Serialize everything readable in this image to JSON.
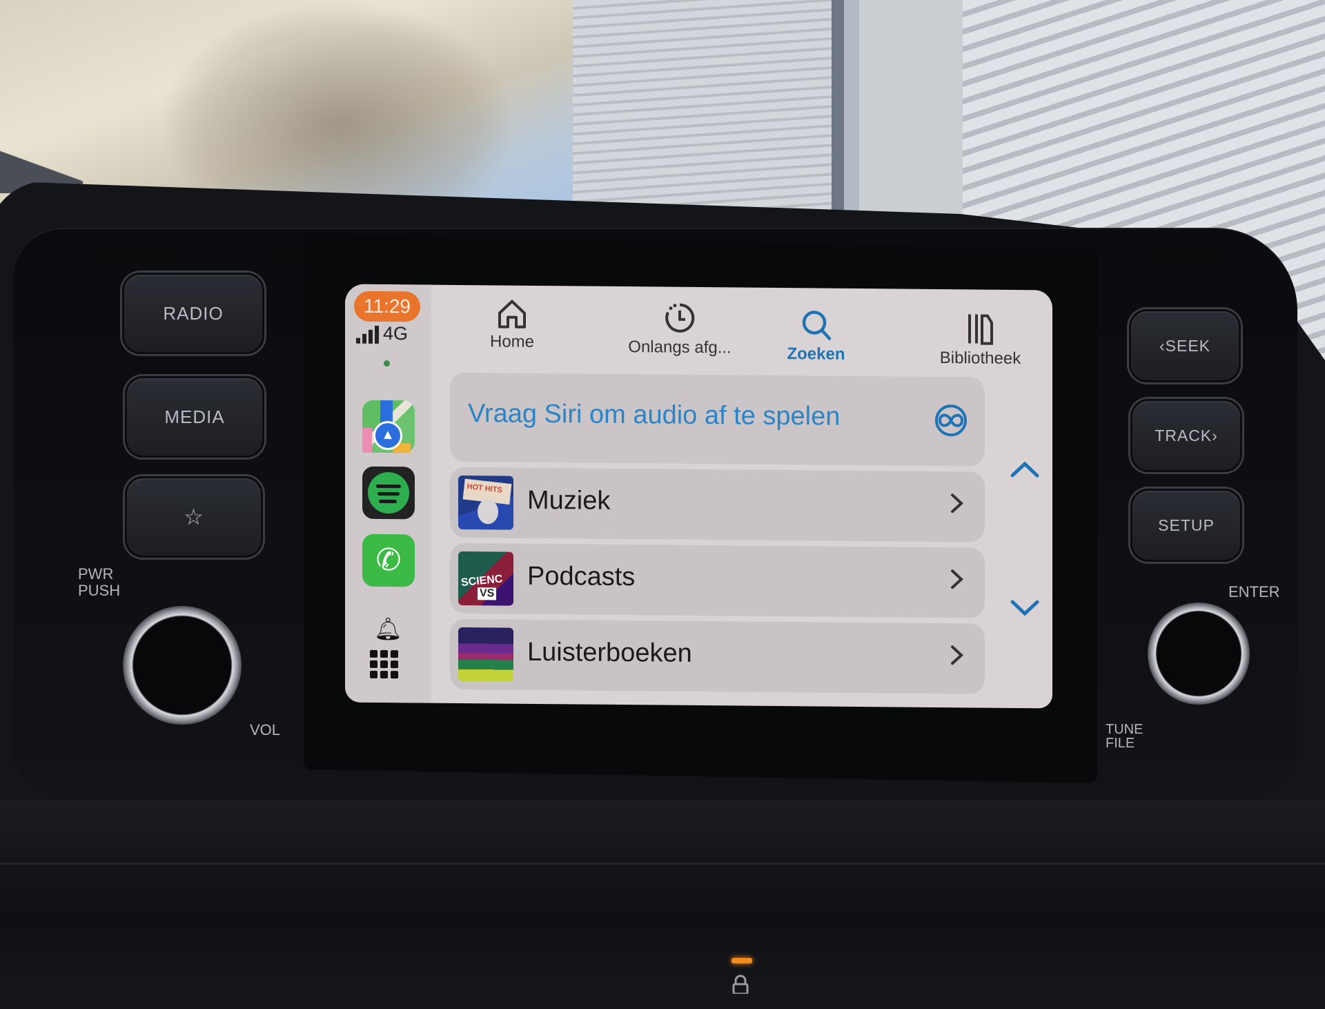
{
  "carplay": {
    "status": {
      "time": "11:29",
      "network": "4G",
      "signal_bars": 4
    },
    "dock": {
      "apps": [
        {
          "name": "Maps",
          "icon": "maps-icon"
        },
        {
          "name": "Spotify",
          "icon": "spotify-icon"
        },
        {
          "name": "Phone",
          "icon": "phone-icon"
        }
      ],
      "notification_icon": "bell-icon",
      "home_grid_icon": "app-grid-icon"
    },
    "tabs": [
      {
        "label": "Home",
        "icon": "home-icon",
        "active": false
      },
      {
        "label": "Onlangs afg...",
        "icon": "recent-clock-icon",
        "active": false
      },
      {
        "label": "Zoeken",
        "icon": "search-icon",
        "active": true
      },
      {
        "label": "Bibliotheek",
        "icon": "library-icon",
        "active": false
      }
    ],
    "siri_prompt": {
      "text": "Vraag Siri om audio af te spelen",
      "icon": "siri-icon"
    },
    "list": [
      {
        "label": "Muziek",
        "art": "music-cover",
        "art_text": "HOT HITS"
      },
      {
        "label": "Podcasts",
        "art": "podcast-cover",
        "art_text_1": "SCIENC",
        "art_text_2": "VS"
      },
      {
        "label": "Luisterboeken",
        "art": "audiobook-cover"
      }
    ],
    "colors": {
      "accent": "#1e73b5",
      "siri_text": "#2a84c8",
      "time_badge": "#e9742c",
      "background": "#d9d3d6",
      "row": "#c9c3c6"
    }
  },
  "head_unit": {
    "left_buttons": [
      "RADIO",
      "MEDIA",
      "☆"
    ],
    "right_buttons": [
      "‹SEEK",
      "TRACK›",
      "SETUP"
    ],
    "pwr_label_1": "PWR",
    "pwr_label_2": "PUSH",
    "vol_label": "VOL",
    "enter_label": "ENTER",
    "tune_label_1": "TUNE",
    "tune_label_2": "FILE"
  }
}
